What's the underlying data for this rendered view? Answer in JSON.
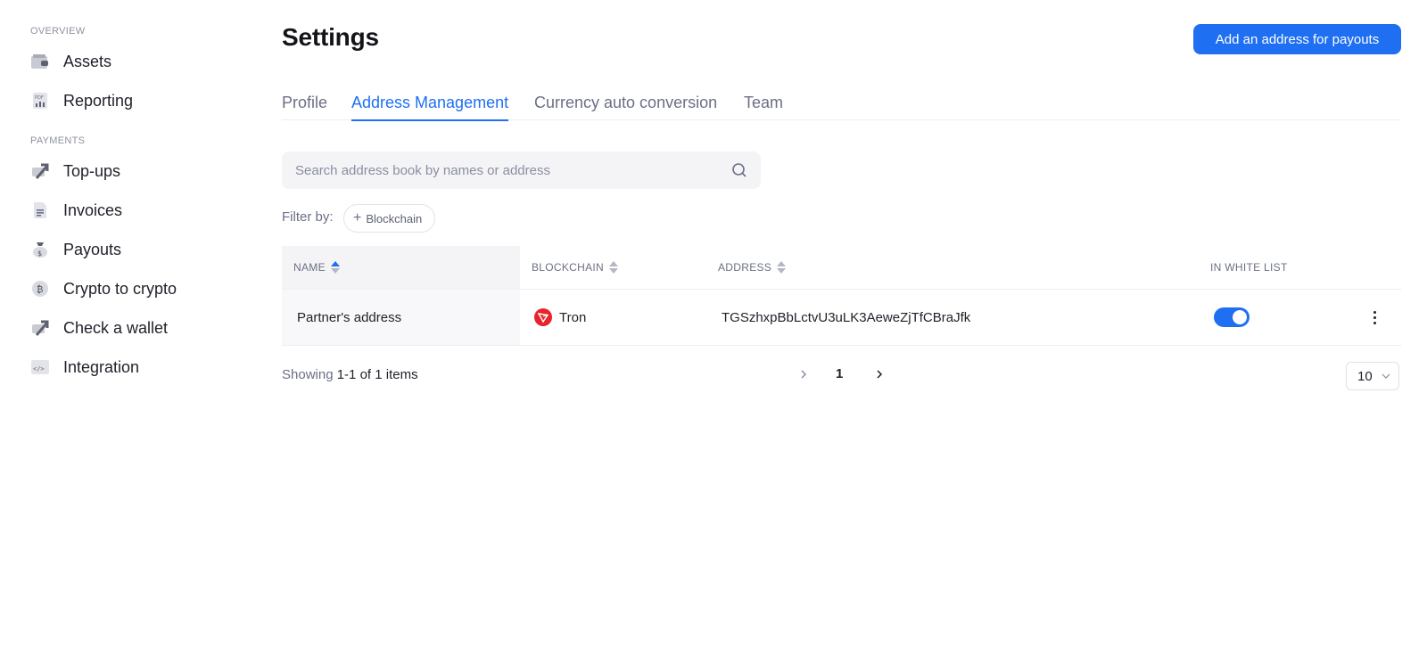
{
  "sidebar": {
    "sections": [
      {
        "label": "OVERVIEW"
      },
      {
        "label": "PAYMENTS"
      }
    ],
    "items": [
      {
        "label": "Assets",
        "icon": "wallet-icon"
      },
      {
        "label": "Reporting",
        "icon": "pdf-report-icon"
      },
      {
        "label": "Top-ups",
        "icon": "topup-arrow-icon"
      },
      {
        "label": "Invoices",
        "icon": "document-icon"
      },
      {
        "label": "Payouts",
        "icon": "money-bag-icon"
      },
      {
        "label": "Crypto to crypto",
        "icon": "bitcoin-coin-icon"
      },
      {
        "label": "Check a wallet",
        "icon": "check-wallet-arrow-icon"
      },
      {
        "label": "Integration",
        "icon": "code-icon"
      }
    ]
  },
  "header": {
    "title": "Settings",
    "primary_button": "Add an address for payouts"
  },
  "tabs": [
    {
      "label": "Profile",
      "active": false
    },
    {
      "label": "Address Management",
      "active": true
    },
    {
      "label": "Currency auto conversion",
      "active": false
    },
    {
      "label": "Team",
      "active": false
    }
  ],
  "search": {
    "placeholder": "Search address book by names or address",
    "value": ""
  },
  "filter": {
    "label": "Filter by:",
    "chip": "Blockchain"
  },
  "table": {
    "columns": [
      "NAME",
      "BLOCKCHAIN",
      "ADDRESS",
      "IN WHITE LIST"
    ],
    "rows": [
      {
        "name": "Partner's address",
        "blockchain": "Tron",
        "address": "TGSzhxpBbLctvU3uLK3AeweZjTfCBraJfk",
        "in_white_list": true
      }
    ]
  },
  "pagination": {
    "showing_prefix": "Showing",
    "showing_range": "1-1 of 1 items",
    "current_page": "1",
    "page_size": "10"
  },
  "colors": {
    "accent": "#1f6ff2",
    "tron_red": "#e8232b"
  }
}
